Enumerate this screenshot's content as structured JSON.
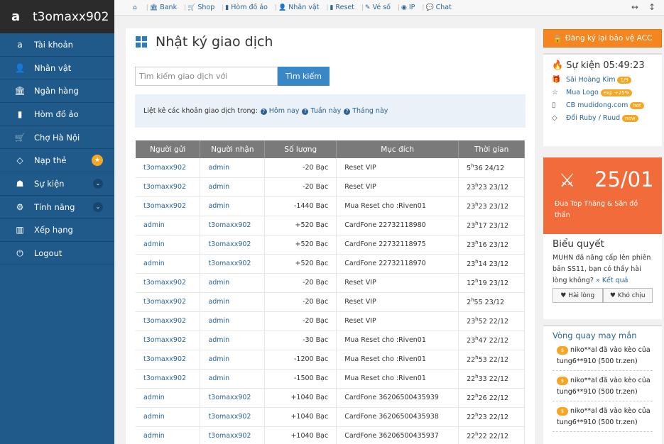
{
  "brand": {
    "logo": "a",
    "name": "t3omaxx902"
  },
  "sidebar": {
    "items": [
      {
        "label": "Tài khoản",
        "icon": "a"
      },
      {
        "label": "Nhân vật",
        "icon": "👤"
      },
      {
        "label": "Ngân hàng",
        "icon": "🏛"
      },
      {
        "label": "Hòm đồ ảo",
        "icon": "▮"
      },
      {
        "label": "Chợ Hà Nội",
        "icon": "🛒"
      },
      {
        "label": "Nạp thẻ",
        "icon": "◇"
      },
      {
        "label": "Sự kiện",
        "icon": "☗"
      },
      {
        "label": "Tính năng",
        "icon": "⚙"
      },
      {
        "label": "Xếp hạng",
        "icon": "▥"
      },
      {
        "label": "Logout",
        "icon": "⏻"
      }
    ]
  },
  "topnav": {
    "home_icon": "⌂",
    "items": [
      {
        "label": "Bank",
        "icon": "🏛"
      },
      {
        "label": "Shop",
        "icon": "🛒"
      },
      {
        "label": "Hòm đồ ảo",
        "icon": "▮"
      },
      {
        "label": "Nhân vật",
        "icon": "👤"
      },
      {
        "label": "Reset",
        "icon": "▮"
      },
      {
        "label": "Vé số",
        "icon": "✎"
      },
      {
        "label": "IP",
        "icon": "◉"
      },
      {
        "label": "Chat",
        "icon": "💬"
      }
    ]
  },
  "main": {
    "title": "Nhật ký giao dịch",
    "search_placeholder": "Tìm kiếm giao dịch với",
    "search_button": "Tìm kiếm",
    "filter_label": "Liệt kê các khoản giao dịch trong:",
    "filters": [
      "Hôm nay",
      "Tuần này",
      "Tháng này"
    ],
    "columns": [
      "Người gửi",
      "Người nhận",
      "Số lượng",
      "Mục đích",
      "Thời gian"
    ],
    "rows": [
      [
        "t3omaxx902",
        "admin",
        "-20  Bạc",
        "Reset VIP",
        "5",
        "36 24/12"
      ],
      [
        "t3omaxx902",
        "admin",
        "-20  Bạc",
        "Reset VIP",
        "23",
        "23 23/12"
      ],
      [
        "t3omaxx902",
        "admin",
        "-1440  Bạc",
        "Mua Reset cho :Riven01",
        "23",
        "23 23/12"
      ],
      [
        "admin",
        "t3omaxx902",
        "+520  Bạc",
        "CardFone 22732118980",
        "23",
        "17 23/12"
      ],
      [
        "admin",
        "t3omaxx902",
        "+520  Bạc",
        "CardFone 22732118975",
        "23",
        "16 23/12"
      ],
      [
        "admin",
        "t3omaxx902",
        "+520  Bạc",
        "CardFone 22732118970",
        "23",
        "14 23/12"
      ],
      [
        "t3omaxx902",
        "admin",
        "-20  Bạc",
        "Reset VIP",
        "12",
        "19 23/12"
      ],
      [
        "t3omaxx902",
        "admin",
        "-20  Bạc",
        "Reset VIP",
        "2",
        "55 23/12"
      ],
      [
        "t3omaxx902",
        "admin",
        "-20  Bạc",
        "Reset VIP",
        "23",
        "52 22/12"
      ],
      [
        "t3omaxx902",
        "admin",
        "-30  Bạc",
        "Mua Reset cho :Riven01",
        "23",
        "47 22/12"
      ],
      [
        "t3omaxx902",
        "admin",
        "-1200  Bạc",
        "Mua Reset cho :Riven01",
        "22",
        "53 22/12"
      ],
      [
        "t3omaxx902",
        "admin",
        "-1500  Bạc",
        "Mua Reset cho :Riven01",
        "22",
        "33 22/12"
      ],
      [
        "admin",
        "t3omaxx902",
        "+1040  Bạc",
        "CardFone 36206500435939",
        "22",
        "26 22/12"
      ],
      [
        "admin",
        "t3omaxx902",
        "+1040  Bạc",
        "CardFone 36206500435938",
        "22",
        "23 22/12"
      ],
      [
        "admin",
        "t3omaxx902",
        "+1040  Bạc",
        "CardFone 36206500435937",
        "22",
        "22 22/12"
      ]
    ]
  },
  "right": {
    "register_button": "Đăng ký lại bảo vệ ACC",
    "event_title": "Sự kiện 05:49:23",
    "events": [
      {
        "label": "Săi Hoàng Kim",
        "badge": "1/9",
        "icon": "🎁"
      },
      {
        "label": "Mua Logo",
        "badge": "exp +25%",
        "icon": "☆"
      },
      {
        "label": "CB mudidong.com",
        "badge": "hot",
        "icon": "▯"
      },
      {
        "label": "Đổi Ruby / Ruud",
        "badge": "new",
        "icon": "◇"
      }
    ],
    "promo_date": "25/01",
    "promo_text": "Đua Top Thăng & Săn đồ thần",
    "poll_title": "Biểu quyết",
    "poll_text": "MUHN đã nâng cấp lên phiên bản SS11, bạn có thấy hài lòng không?",
    "poll_link": "» Kết quả",
    "poll_yes": "♥ Hài lòng",
    "poll_no": "♥ Khó chịu",
    "wheel_title": "Vòng quay may mắn",
    "wheel_items": [
      "niko**al đã vào kèo của tung6**910 (500 tr.zen)",
      "niko**al đã vào kèo của tung6**910 (500 tr.zen)",
      "niko**al đã vào kèo của tung6**910 (500 tr.zen)"
    ]
  }
}
